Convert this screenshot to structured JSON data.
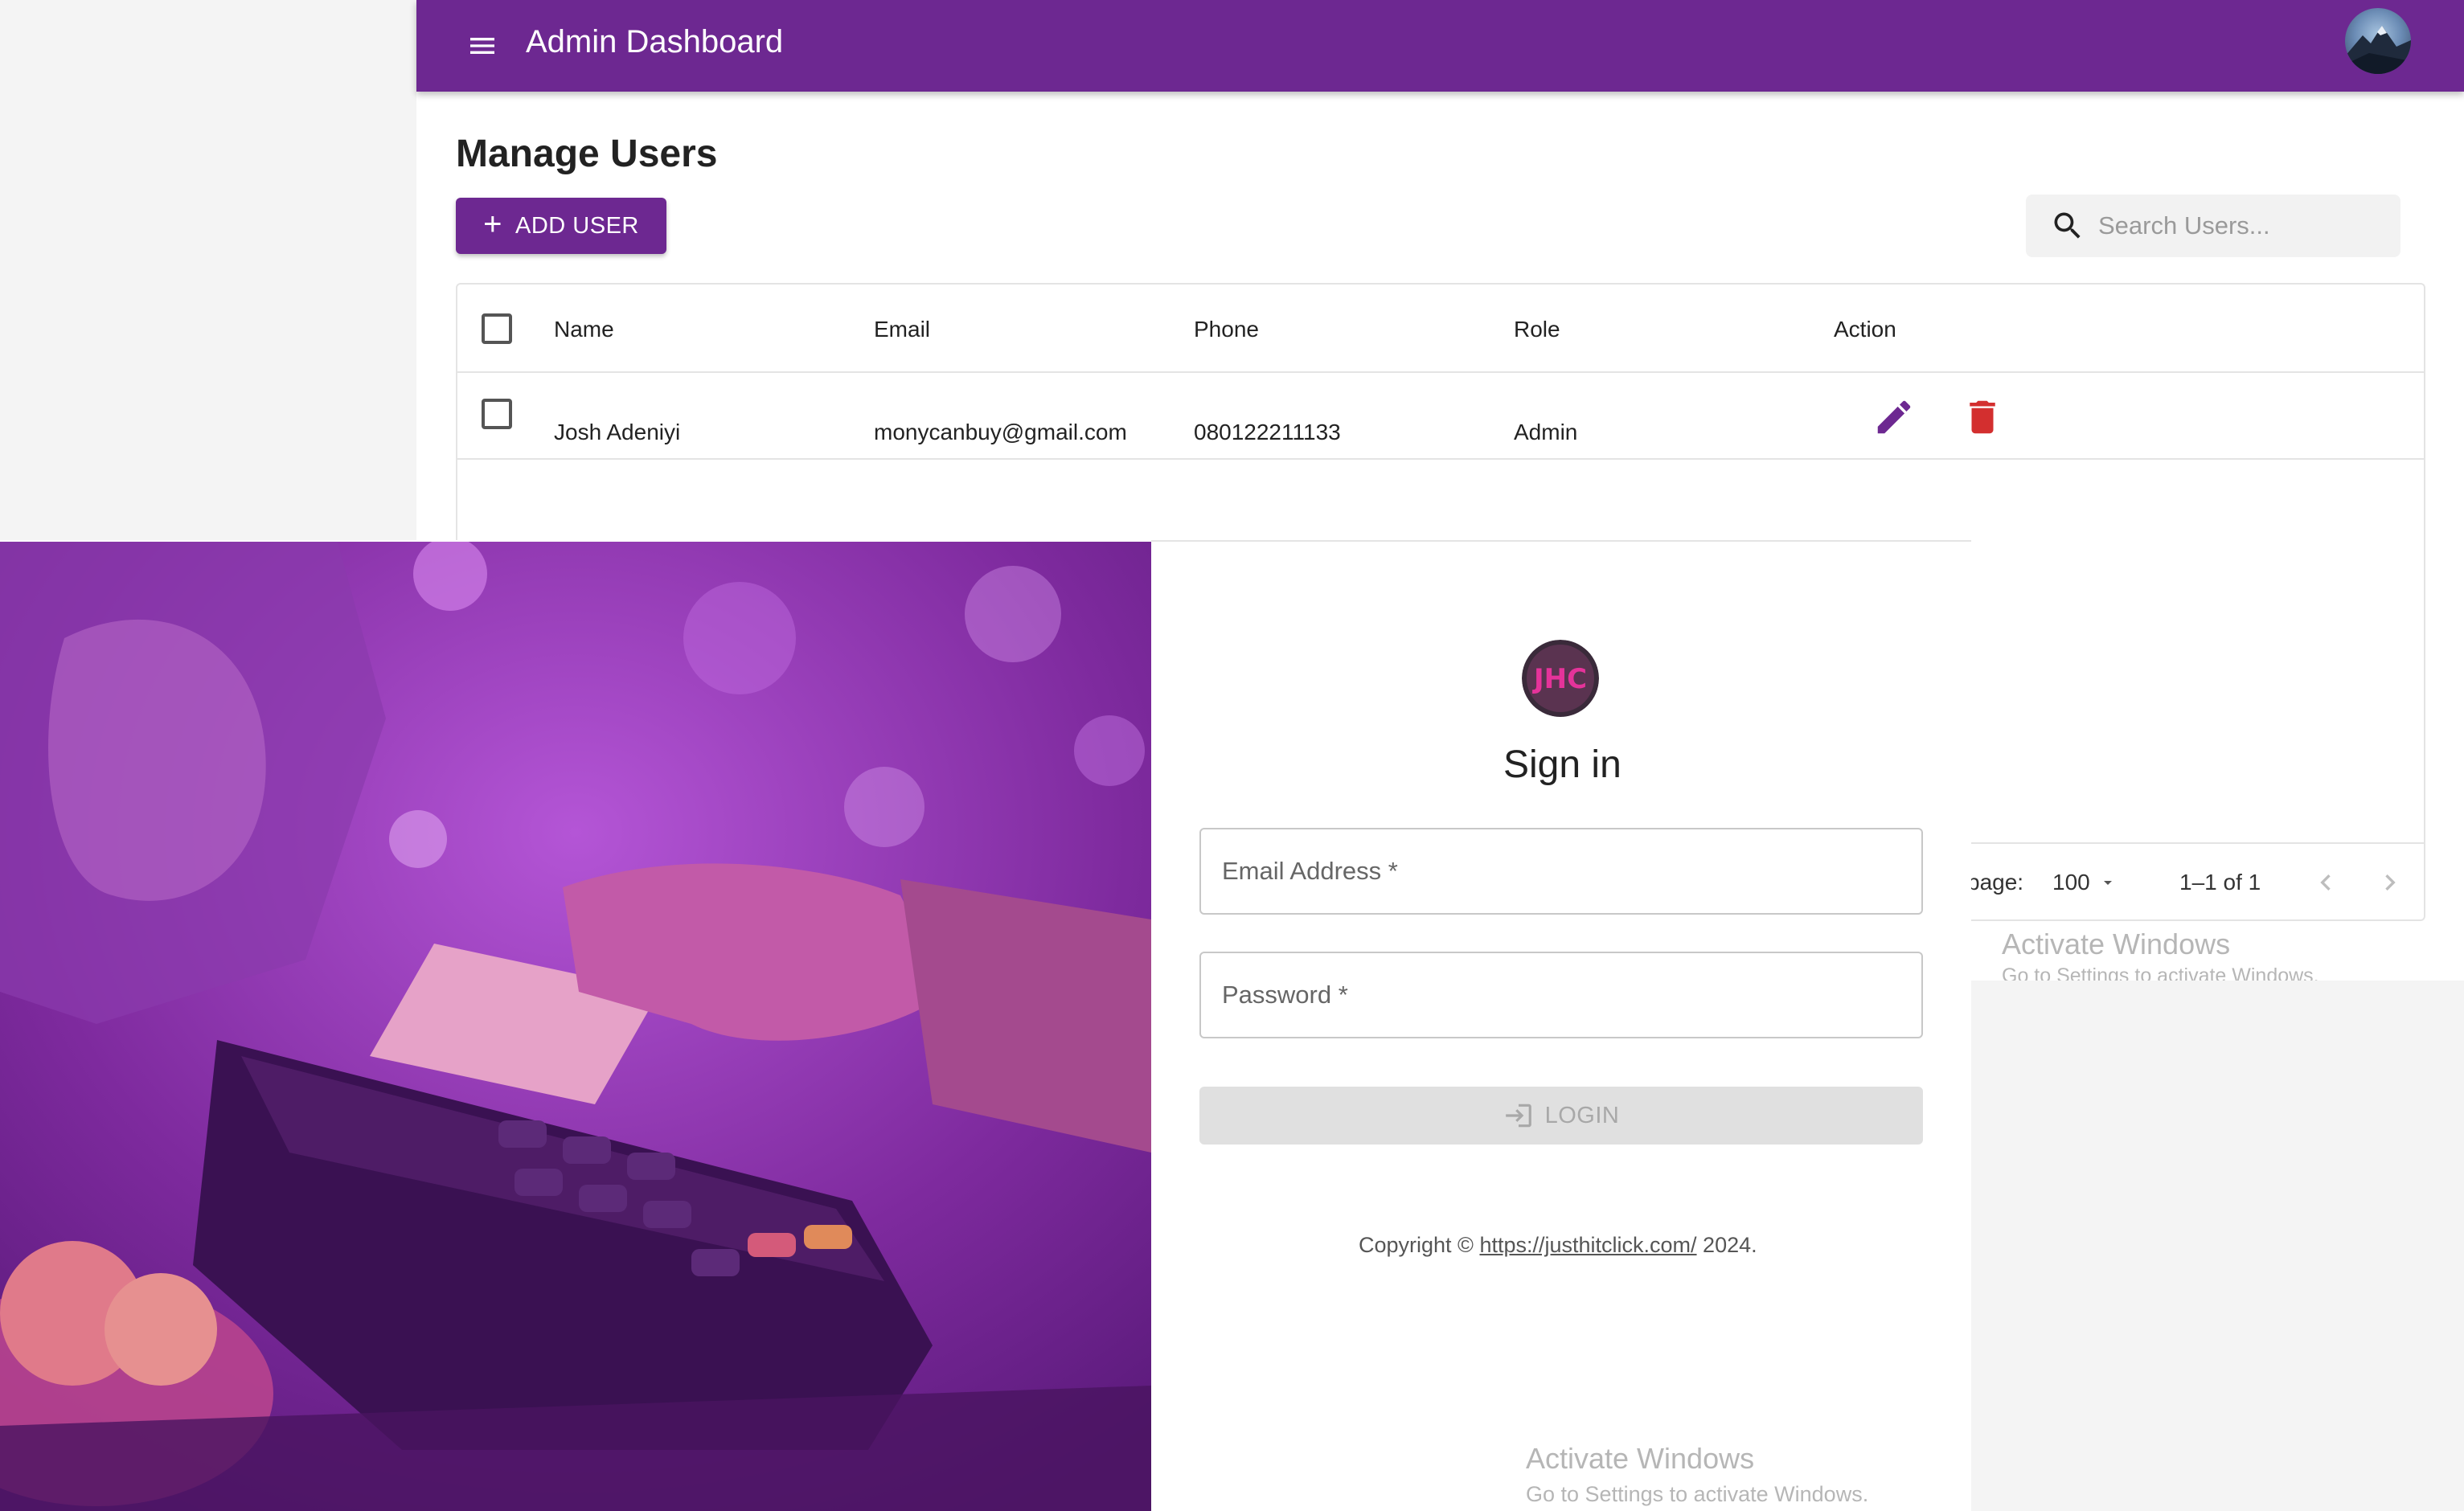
{
  "header": {
    "title": "Admin Dashboard"
  },
  "main": {
    "page_title": "Manage Users",
    "add_user_label": "ADD USER",
    "search_placeholder": "Search Users..."
  },
  "table": {
    "columns": [
      "Name",
      "Email",
      "Phone",
      "Role",
      "Action"
    ],
    "rows": [
      {
        "name": "Josh Adeniyi",
        "email": "monycanbuy@gmail.com",
        "phone": "080122211133",
        "role": "Admin"
      }
    ],
    "footer": {
      "rows_per_page_label": "page:",
      "rows_per_page_value": "100",
      "range": "1–1 of 1"
    }
  },
  "signin": {
    "title": "Sign in",
    "email_label": "Email Address *",
    "password_label": "Password *",
    "login_label": "LOGIN",
    "copyright_prefix": "Copyright © ",
    "copyright_link": "https://justhitclick.com/",
    "copyright_suffix": " 2024."
  },
  "watermark": {
    "title": "Activate Windows",
    "subtitle": "Go to Settings to activate Windows."
  },
  "colors": {
    "brand": "#6d2891",
    "delete": "#d32f2f"
  },
  "icons": [
    "menu-icon",
    "search-icon",
    "plus-icon",
    "edit-icon",
    "delete-icon",
    "chevron-left-icon",
    "chevron-right-icon",
    "caret-down-icon",
    "login-icon"
  ]
}
